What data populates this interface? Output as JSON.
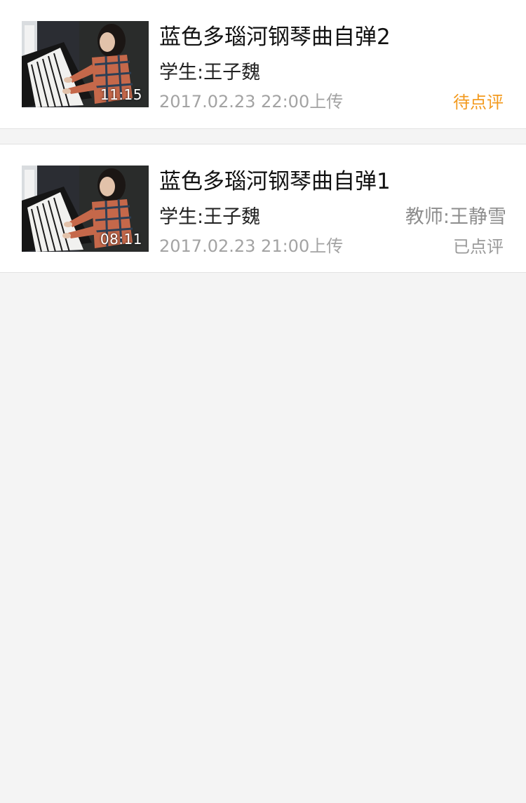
{
  "videos": [
    {
      "title": "蓝色多瑙河钢琴曲自弹2",
      "student": "学生:王子魏",
      "teacher": "",
      "upload_time": "2017.02.23  22:00上传",
      "status": "待点评",
      "status_color": "#f39a1e",
      "duration": "11:15"
    },
    {
      "title": "蓝色多瑙河钢琴曲自弹1",
      "student": "学生:王子魏",
      "teacher": "教师:王静雪",
      "upload_time": "2017.02.23  21:00上传",
      "status": "已点评",
      "status_color": "#9a9a9a",
      "duration": "08:11"
    }
  ],
  "colors": {
    "background": "#f4f4f4",
    "card": "#ffffff",
    "pending_status": "#f39a1e",
    "reviewed_status": "#9a9a9a"
  },
  "icons": {
    "thumbnail": "video-thumbnail-piano"
  }
}
